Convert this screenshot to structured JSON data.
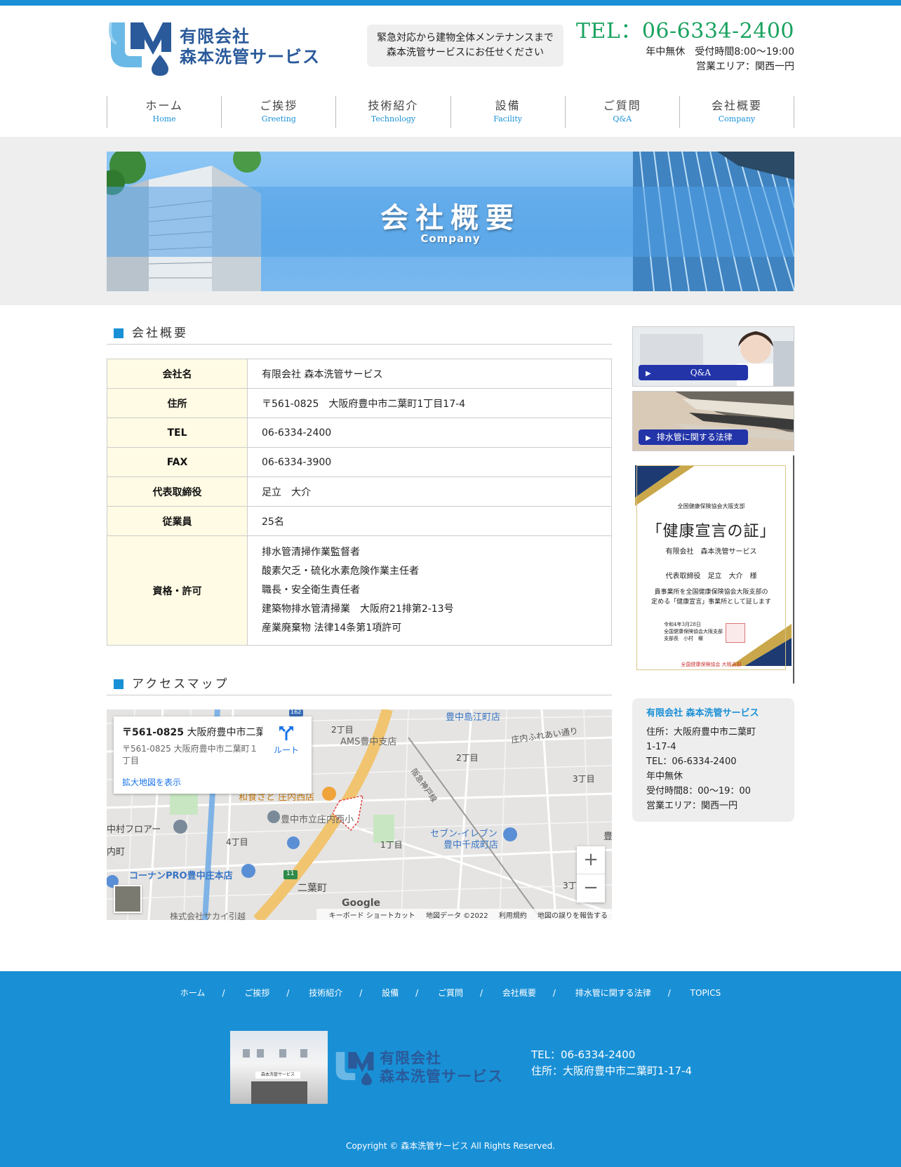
{
  "header": {
    "logo_text_line1": "有限会社",
    "logo_text_line2": "森本洗管サービス",
    "catch_line1": "緊急対応から建物全体メンテナンスまで",
    "catch_line2": "森本洗管サービスにお任せください",
    "tel": "TEL：06-6334-2400",
    "hours": "年中無休　受付時間8:00～19:00",
    "area": "営業エリア：関西一円"
  },
  "nav": [
    {
      "jp": "ホーム",
      "en": "Home"
    },
    {
      "jp": "ご挨拶",
      "en": "Greeting"
    },
    {
      "jp": "技術紹介",
      "en": "Technology"
    },
    {
      "jp": "設備",
      "en": "Facility"
    },
    {
      "jp": "ご質問",
      "en": "Q&A"
    },
    {
      "jp": "会社概要",
      "en": "Company"
    }
  ],
  "banner": {
    "title": "会社概要",
    "subtitle": "Company"
  },
  "company_section": {
    "title": "会社概要",
    "rows": [
      {
        "label": "会社名",
        "value": "有限会社 森本洗管サービス"
      },
      {
        "label": "住所",
        "value": "〒561-0825　大阪府豊中市二葉町1丁目17-4"
      },
      {
        "label": "TEL",
        "value": "06-6334-2400"
      },
      {
        "label": "FAX",
        "value": "06-6334-3900"
      },
      {
        "label": "代表取締役",
        "value": "足立　大介"
      },
      {
        "label": "従業員",
        "value": "25名"
      }
    ],
    "license_label": "資格・許可",
    "licenses": [
      "排水管清掃作業監督者",
      "酸素欠乏・硫化水素危険作業主任者",
      "職長・安全衛生責任者",
      "建築物排水管清掃業　大阪府21排第2-13号",
      "産業廃棄物 法律14条第1項許可"
    ]
  },
  "access_section": {
    "title": "アクセスマップ",
    "map": {
      "card_title_bold": "〒561-0825",
      "card_title_rest": " 大阪府豊中市二葉...",
      "card_address": "〒561-0825 大阪府豊中市二葉町１丁目",
      "card_link": "拡大地図を表示",
      "route_label": "ルート",
      "zoom_in": "+",
      "zoom_out": "−",
      "google": "Google",
      "footer_items": [
        "キーボード ショートカット",
        "地図データ ©2022",
        "利用規約",
        "地図の誤りを報告する"
      ],
      "labels": {
        "l1": "豊中島江町店",
        "l2": "AMS豊中支店",
        "l3": "庄内ふれあい通り",
        "l4": "阪急神戸線",
        "l5": "2丁目",
        "l6": "2丁目",
        "l7": "3丁目",
        "l8": "和食さと 庄内西店",
        "l9": "豊中市立庄内西小",
        "l10": "セブン-イレブン",
        "l11": "豊中千成町店",
        "l12": "中村フロアー",
        "l13": "4丁目",
        "l14": "1丁目",
        "l15": "コーナンPRO豊中庄本店",
        "l16": "二葉町",
        "l17": "3丁",
        "l18": "株式会社サカイ引越",
        "l19": "内町",
        "l20": "豊",
        "l21": "11",
        "l22": "162"
      }
    }
  },
  "side": {
    "banner_qa": "Q&A",
    "banner_law": "排水管に関する法律",
    "cert": {
      "org": "全国健康保険協会大阪支部",
      "title": "「健康宣言の証」",
      "company": "有限会社　森本洗管サービス",
      "rep": "代表取締役　足立　大介　様",
      "text1": "貴事業所を全国健康保険協会大阪支部の",
      "text2": "定める「健康宣言」事業所として証します",
      "date1": "令和4年3月28日",
      "date2": "全国健康保険協会大阪支部",
      "date3": "支部長　小村　穣",
      "foot": "全国健康保険協会 大阪支部"
    },
    "info": {
      "name": "有限会社 森本洗管サービス",
      "addr1": "住所：大阪府豊中市二葉町",
      "addr2": "1-17-4",
      "tel": "TEL：06-6334-2400",
      "open": "年中無休",
      "hours": "受付時間8：00～19：00",
      "area": "営業エリア：関西一円"
    }
  },
  "footer": {
    "nav": [
      "ホーム",
      "ご挨拶",
      "技術紹介",
      "設備",
      "ご質問",
      "会社概要",
      "排水管に関する法律",
      "TOPICS"
    ],
    "separator": "/",
    "photo_sign": "森本洗管サービス",
    "logo_line1": "有限会社",
    "logo_line2": "森本洗管サービス",
    "tel": "TEL：06-6334-2400",
    "addr": "住所：大阪府豊中市二葉町1-17-4",
    "copyright": "Copyright © 森本洗管サービス All Rights Reserved."
  },
  "colors": {
    "brand_blue": "#1990d6",
    "tel_green": "#1aa260",
    "table_th": "#fffbe5",
    "logo_navy": "#2a5a9a"
  }
}
